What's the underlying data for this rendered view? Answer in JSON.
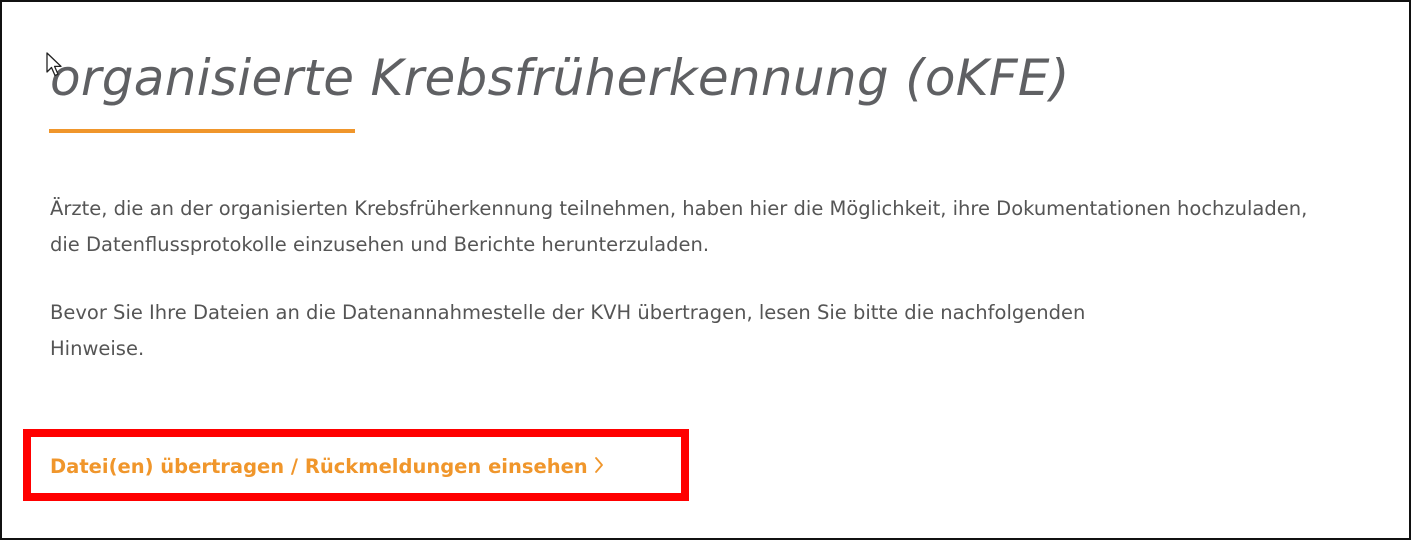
{
  "page": {
    "title": "organisierte Krebsfrüherkennung (oKFE)",
    "intro": "Ärzte, die an der organisierten Krebsfrüherkennung teilnehmen, haben hier die Möglichkeit, ihre Dokumentationen hochzuladen, die Datenflussprotokolle einzusehen und Berichte herunterzuladen.",
    "notice": "Bevor Sie Ihre Dateien an die Datenannahmestelle der KVH übertragen, lesen Sie bitte die nachfolgenden Hinweise.",
    "upload_link": {
      "label": "Datei(en) übertragen / Rückmeldungen einsehen",
      "icon": "chevron-right-icon"
    }
  },
  "colors": {
    "accent": "#f0962b",
    "title": "#5f6063",
    "body_text": "#555555",
    "highlight": "#ff0000",
    "frame": "#111111"
  }
}
